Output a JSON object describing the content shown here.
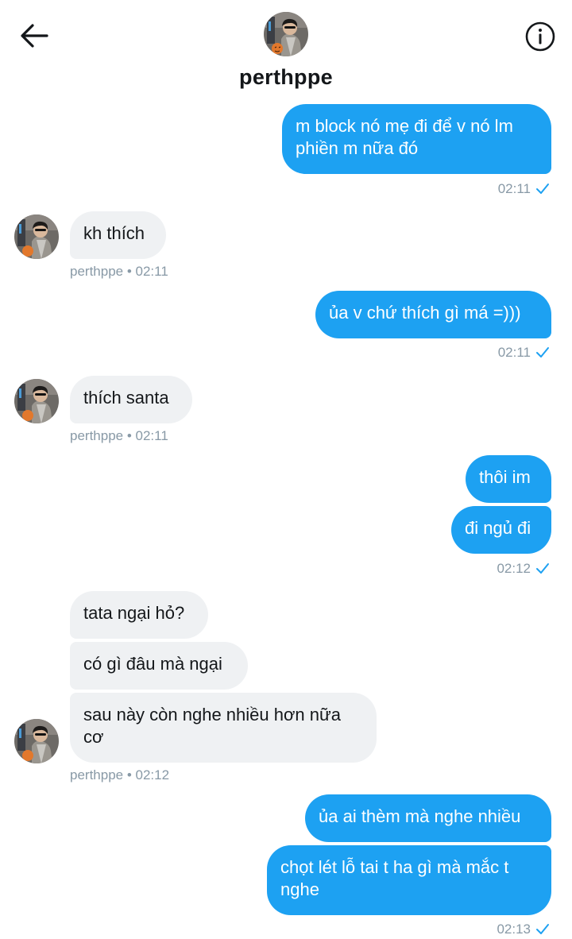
{
  "header": {
    "username": "perthppe",
    "back_icon": "arrow-left-icon",
    "info_icon": "info-circle-icon"
  },
  "colors": {
    "outgoing_bubble": "#1da1f2",
    "incoming_bubble": "#eff1f3",
    "meta_text": "#8899a6"
  },
  "messages": [
    {
      "dir": "out",
      "text": "m block nó mẹ đi để v nó lm\nphiền m nữa đó",
      "time": "02:11"
    },
    {
      "dir": "in",
      "text": "kh thích",
      "meta": "perthppe • 02:11"
    },
    {
      "dir": "out",
      "text": "ủa v chứ thích gì má =)))",
      "time": "02:11"
    },
    {
      "dir": "in",
      "text": "thích santa",
      "meta": "perthppe • 02:11"
    },
    {
      "dir": "out",
      "text": "thôi im"
    },
    {
      "dir": "out",
      "text": "đi ngủ đi",
      "time": "02:12"
    },
    {
      "dir": "in",
      "text": "tata ngại hỏ?"
    },
    {
      "dir": "in",
      "text": "có gì đâu mà ngại"
    },
    {
      "dir": "in",
      "text": "sau này còn nghe nhiều hơn nữa\ncơ",
      "meta": "perthppe • 02:12"
    },
    {
      "dir": "out",
      "text": "ủa ai thèm mà nghe nhiều"
    },
    {
      "dir": "out",
      "text": "chọt lét lỗ tai t ha gì mà mắc t\nnghe",
      "time": "02:13"
    }
  ]
}
